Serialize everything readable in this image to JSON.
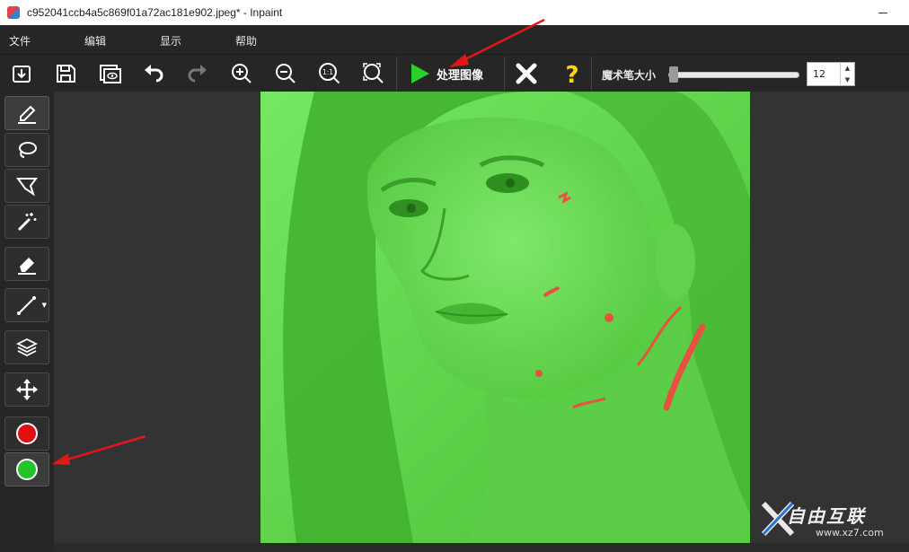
{
  "window": {
    "title": "c952041ccb4a5c869f01a72ac181e902.jpeg* - Inpaint"
  },
  "menu": {
    "file": "文件",
    "edit": "编辑",
    "view": "显示",
    "help": "帮助"
  },
  "toolbar": {
    "process_label": "处理图像",
    "brush_size_label": "魔术笔大小",
    "brush_size_value": "12",
    "brush_size_level": 0.02
  },
  "tools": [
    "marker-icon",
    "lasso-icon",
    "polygon-lasso-icon",
    "magic-wand-icon",
    "eraser-icon",
    "line-icon",
    "layers-icon",
    "move-icon"
  ],
  "colors": {
    "red_swatch": "#e01010",
    "green_swatch": "#22c42a",
    "mask_overlay": "#52c83c",
    "accent_arrow": "#e01818"
  },
  "watermark": {
    "brand": "自由互联",
    "url": "www.xz7.com"
  }
}
